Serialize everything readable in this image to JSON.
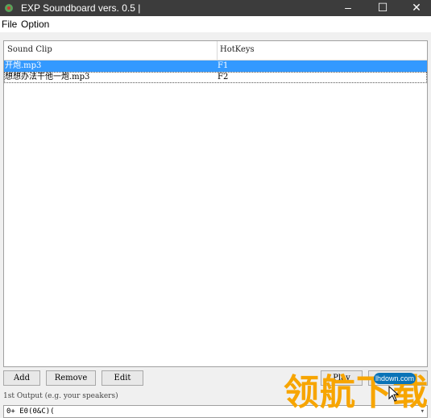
{
  "window": {
    "title": "EXP Soundboard vers. 0.5 |",
    "controls": {
      "minimize": "–",
      "maximize": "☐",
      "close": "✕"
    }
  },
  "menu": {
    "items": [
      "File",
      "Option"
    ]
  },
  "table": {
    "columns": [
      "Sound Clip",
      "HotKeys"
    ],
    "rows": [
      {
        "clip": "开炮.mp3",
        "hotkey": "F1",
        "selected": true
      },
      {
        "clip": "想想办法干他一炮.mp3",
        "hotkey": "F2",
        "selected": false
      }
    ]
  },
  "buttons": {
    "add": "Add",
    "remove": "Remove",
    "edit": "Edit",
    "play": "Play"
  },
  "output": {
    "label": "1st Output (e.g. your speakers)",
    "selected_value": "0+ E0(0&C)("
  },
  "watermark": {
    "text": "领航下载",
    "badge": "lhdown.com"
  },
  "colors": {
    "titlebar": "#3c3c3c",
    "selection": "#3399ff",
    "watermark": "#f7a500",
    "badge": "#0a73b7"
  }
}
